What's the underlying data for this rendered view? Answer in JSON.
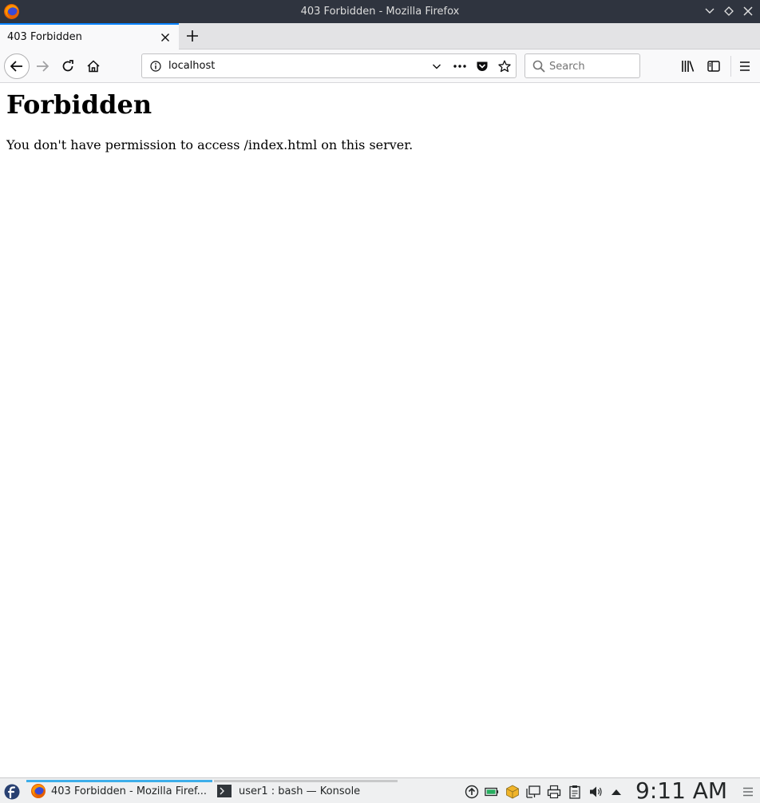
{
  "window": {
    "title": "403 Forbidden - Mozilla Firefox"
  },
  "tabs": [
    {
      "label": "403 Forbidden",
      "active": true
    }
  ],
  "navbar": {
    "url": "localhost",
    "search_placeholder": "Search"
  },
  "page": {
    "heading": "Forbidden",
    "message": "You don't have permission to access /index.html on this server."
  },
  "taskbar": {
    "tasks": [
      {
        "label": "403 Forbidden - Mozilla Firef...",
        "icon": "firefox-icon",
        "active": true
      },
      {
        "label": "user1 : bash — Konsole",
        "icon": "konsole-icon",
        "active": false
      }
    ],
    "clock": "9:11 AM"
  },
  "colors": {
    "titlebar_bg": "#2f343f",
    "tab_accent": "#0a84ff",
    "taskbar_bg": "#eff0f1"
  }
}
